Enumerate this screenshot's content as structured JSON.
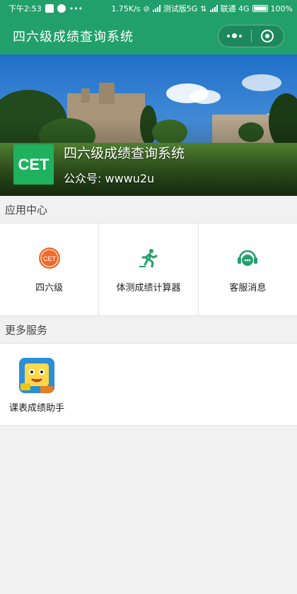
{
  "status_bar": {
    "time": "下午2:53",
    "speed": "1.75K/s",
    "carrier1": "测试版5G",
    "carrier2": "联通 4G",
    "battery": "100%"
  },
  "nav": {
    "title": "四六级成绩查询系统",
    "menu_icon": "more-dots-icon",
    "close_icon": "target-circle-icon"
  },
  "banner": {
    "logo_text": "CET",
    "title": "四六级成绩查询系统",
    "subtitle": "公众号: wwwu2u"
  },
  "app_center": {
    "header": "应用中心",
    "items": [
      {
        "label": "四六级",
        "icon": "cet-badge-icon",
        "badge_text": "CET",
        "color": "#f06a2c"
      },
      {
        "label": "体测成绩计算器",
        "icon": "running-man-icon",
        "color": "#22a06b"
      },
      {
        "label": "客服消息",
        "icon": "headset-chat-icon",
        "color": "#22a06b"
      }
    ]
  },
  "more_services": {
    "header": "更多服务",
    "items": [
      {
        "label": "课表成绩助手",
        "icon": "cartoon-student-icon"
      }
    ]
  },
  "colors": {
    "primary": "#22a06b",
    "accent": "#f06a2c"
  }
}
